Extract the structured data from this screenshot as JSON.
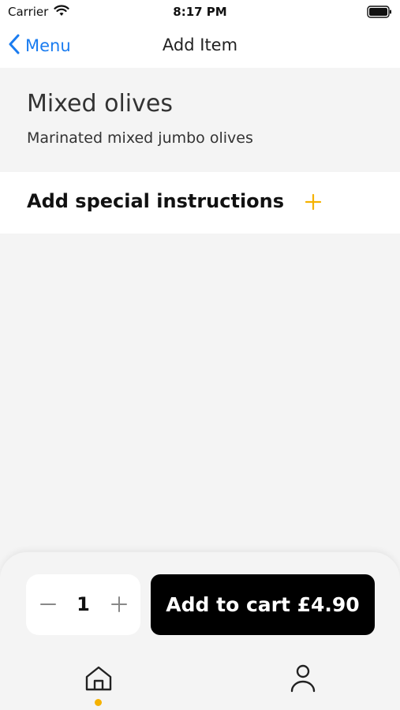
{
  "status_bar": {
    "carrier": "Carrier",
    "time": "8:17 PM"
  },
  "nav": {
    "back_label": "Menu",
    "title": "Add Item"
  },
  "item": {
    "name": "Mixed olives",
    "description": "Marinated mixed jumbo olives"
  },
  "instructions": {
    "label": "Add special instructions",
    "icon": "plus-icon"
  },
  "cart": {
    "quantity": "1",
    "button_label": "Add to cart £4.90"
  },
  "tabs": [
    {
      "icon": "home-icon",
      "active": true
    },
    {
      "icon": "profile-icon",
      "active": false
    }
  ],
  "colors": {
    "accent": "#f5b200",
    "link": "#1a7cf0",
    "cart_button": "#000000",
    "background": "#f4f4f4"
  }
}
